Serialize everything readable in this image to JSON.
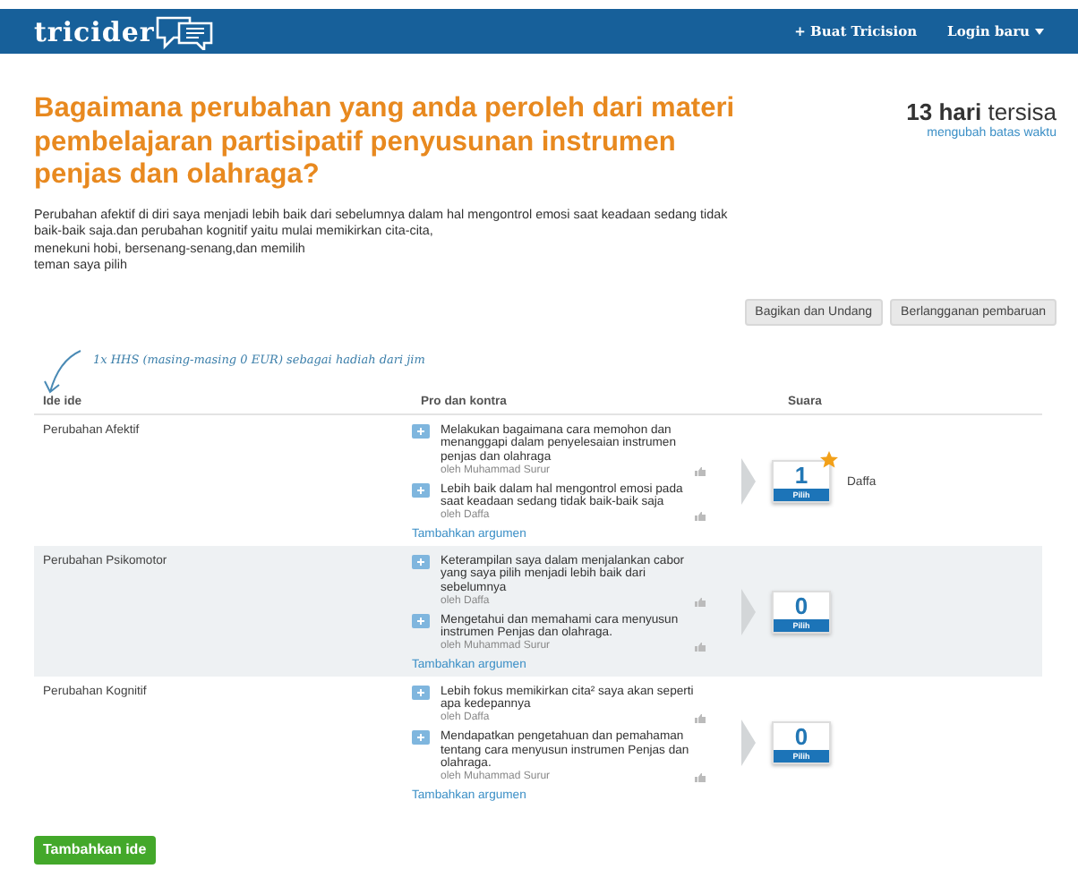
{
  "header": {
    "logo": "tricider",
    "links": [
      "+ Buat Tricision",
      "Login baru"
    ]
  },
  "question": {
    "title": "Bagaimana perubahan yang anda peroleh dari materi pembelajaran partisipatif penyusunan instrumen penjas dan olahraga?",
    "description": [
      "Perubahan afektif di diri saya menjadi lebih baik dari sebelumnya dalam hal mengontrol emosi saat keadaan sedang tidak baik-baik saja.dan perubahan kognitif yaitu mulai memikirkan cita-cita,",
      "menekuni hobi, bersenang-senang,dan memilih",
      "teman saya pilih"
    ],
    "days_left": "13 hari",
    "days_suffix": "tersisa",
    "deadline_link": "mengubah batas waktu"
  },
  "actions": [
    "Bagikan dan Undang",
    "Berlangganan pembaruan"
  ],
  "prize_note": "1x HHS (masing-masing 0 EUR) sebagai hadiah dari jim",
  "table": {
    "columns": [
      "Ide ide",
      "Pro dan kontra",
      "Suara"
    ],
    "rows": [
      {
        "idea": "Perubahan Afektif",
        "winner": true,
        "votes": "1",
        "vote_button": "Pilih",
        "voters": "Daffa",
        "add_argument": "Tambahkan argumen",
        "arguments": [
          {
            "text": "Melakukan bagaimana cara memohon dan menanggapi dalam penyelesaian instrumen penjas dan olahraga",
            "author": "oleh Muhammad Surur"
          },
          {
            "text": "Lebih baik dalam hal mengontrol emosi pada saat keadaan sedang tidak baik-baik saja",
            "author": "oleh Daffa"
          }
        ]
      },
      {
        "idea": "Perubahan Psikomotor",
        "winner": false,
        "votes": "0",
        "vote_button": "Pilih",
        "add_argument": "Tambahkan argumen",
        "arguments": [
          {
            "text": "Keterampilan saya dalam menjalankan cabor yang saya pilih menjadi lebih baik dari sebelumnya",
            "author": "oleh Daffa"
          },
          {
            "text": "Mengetahui dan memahami cara menyusun instrumen Penjas dan olahraga.",
            "author": "oleh Muhammad Surur"
          }
        ]
      },
      {
        "idea": "Perubahan Kognitif",
        "winner": false,
        "votes": "0",
        "vote_button": "Pilih",
        "add_argument": "Tambahkan argumen",
        "arguments": [
          {
            "text": "Lebih fokus memikirkan cita² saya akan seperti apa kedepannya",
            "author": "oleh Daffa"
          },
          {
            "text": "Mendapatkan pengetahuan dan pemahaman tentang cara menyusun instrumen Penjas dan olahraga.",
            "author": "oleh Muhammad Surur"
          }
        ]
      }
    ]
  },
  "add_idea_button": "Tambahkan ide"
}
